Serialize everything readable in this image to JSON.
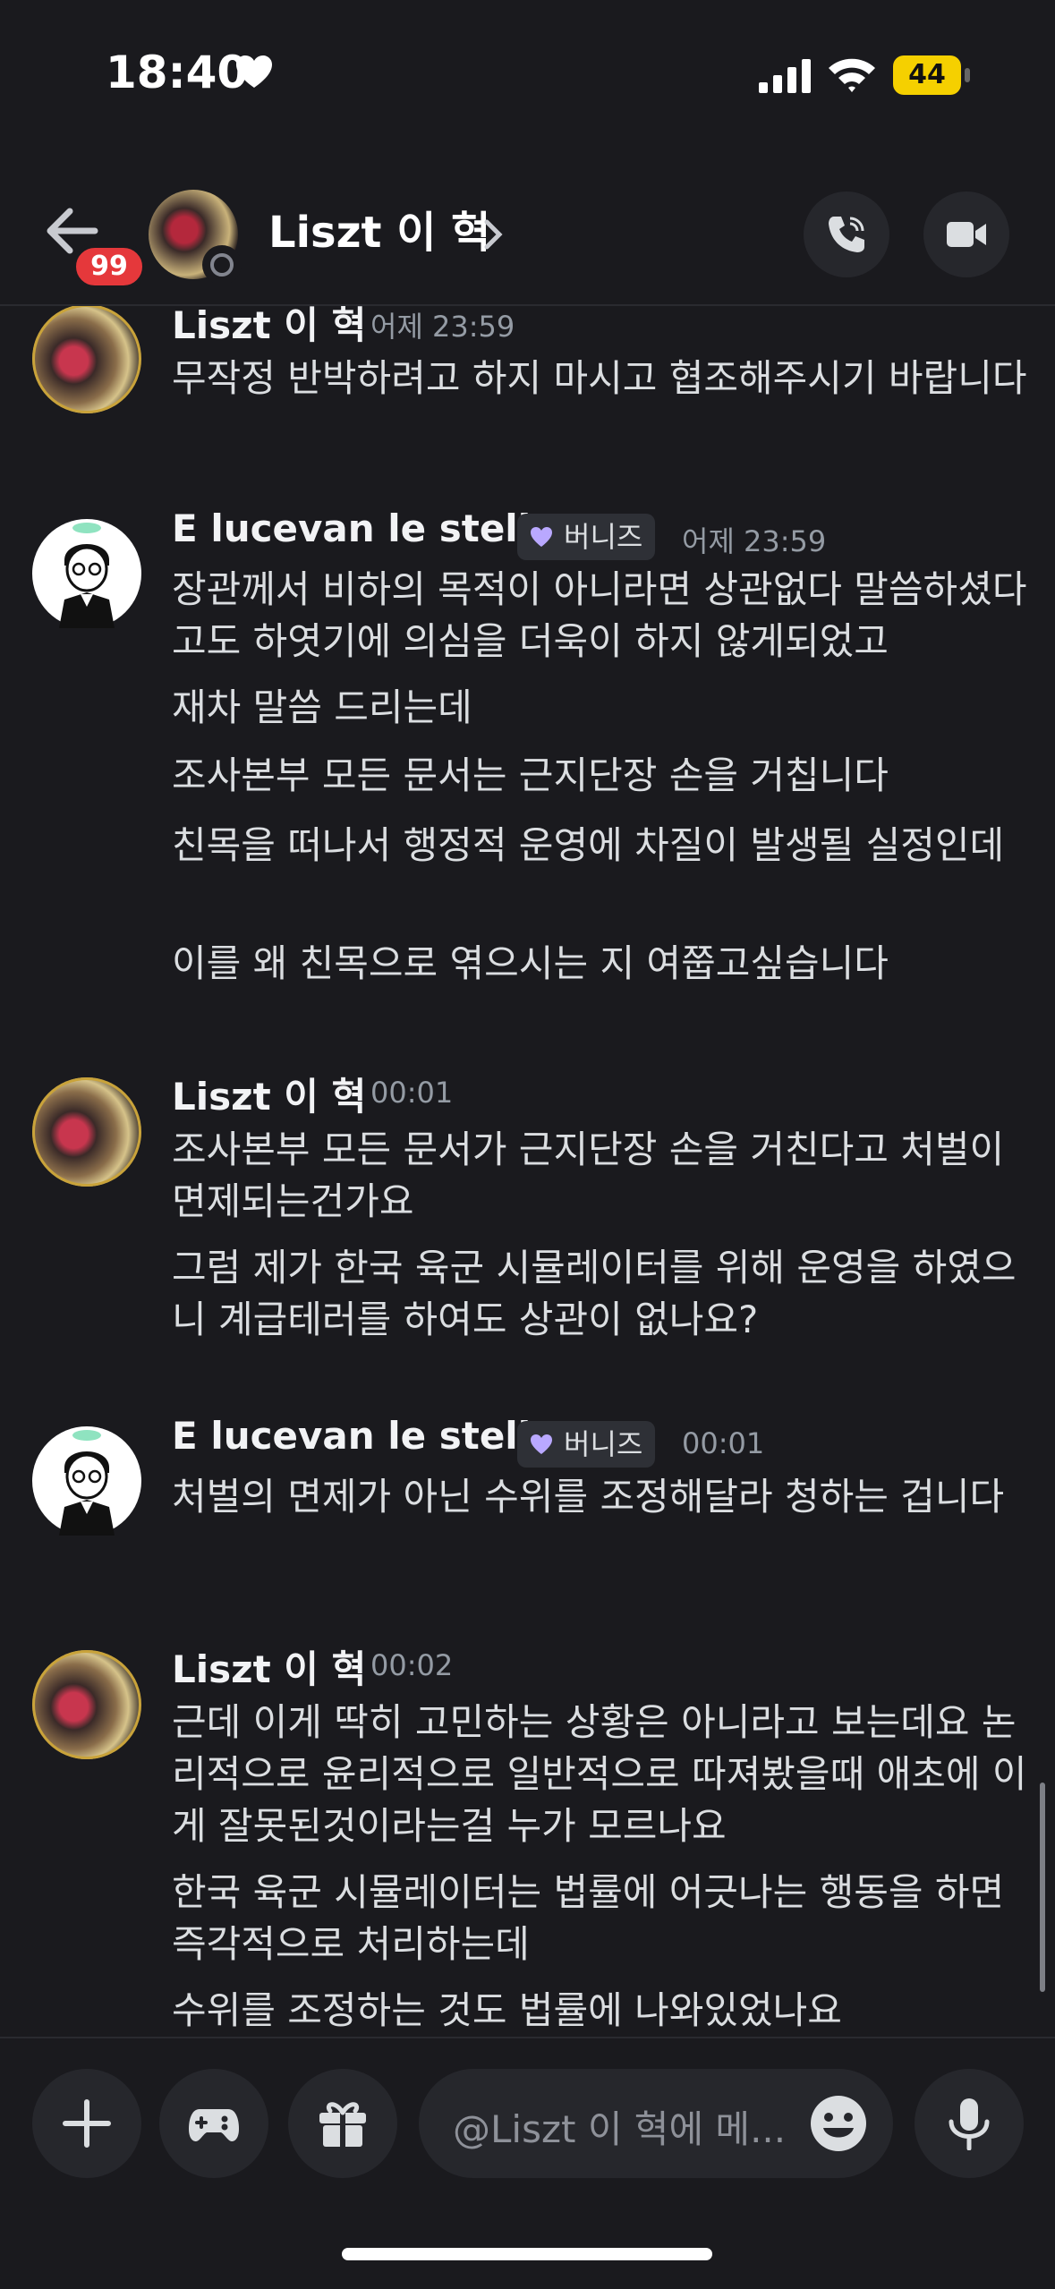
{
  "status_bar": {
    "time": "18:40",
    "battery": "44"
  },
  "header": {
    "unread_badge": "99",
    "title": "Liszt 이 혁"
  },
  "messages": [
    {
      "author": "Liszt 이 혁",
      "time": "어제 23:59",
      "lines": [
        "무작정 반박하려고 하지 마시고 협조해주시기 바랍니다"
      ]
    },
    {
      "author": "E lucevan le stelle",
      "tag": "버니즈",
      "time": "어제 23:59",
      "lines": [
        "장관께서 비하의 목적이 아니라면 상관없다 말씀하셨다고도 하엿기에 의심을 더욱이 하지 않게되었고",
        "재차 말씀 드리는데",
        "조사본부 모든 문서는 근지단장 손을 거칩니다",
        "친목을 떠나서 행정적 운영에 차질이 발생될 실정인데",
        "이를 왜 친목으로 엮으시는 지 여쭙고싶습니다"
      ]
    },
    {
      "author": "Liszt 이 혁",
      "time": "00:01",
      "lines": [
        "조사본부 모든 문서가 근지단장 손을 거친다고 처벌이 면제되는건가요",
        "그럼 제가 한국 육군 시뮬레이터를 위해 운영을 하였으니 계급테러를 하여도 상관이 없나요?"
      ]
    },
    {
      "author": "E lucevan le stelle",
      "tag": "버니즈",
      "time": "00:01",
      "lines": [
        "처벌의 면제가 아닌 수위를 조정해달라 청하는 겁니다"
      ]
    },
    {
      "author": "Liszt 이 혁",
      "time": "00:02",
      "lines": [
        "근데 이게 딱히 고민하는 상황은 아니라고 보는데요 논리적으로 윤리적으로 일반적으로 따져봤을때 애초에 이게 잘못된것이라는걸 누가 모르나요",
        "한국 육군 시뮬레이터는 법률에 어긋나는 행동을 하면 즉각적으로 처리하는데",
        "수위를 조정하는 것도 법률에 나와있었나요"
      ]
    }
  ],
  "composer": {
    "placeholder": "@Liszt 이 혁에 메..."
  }
}
